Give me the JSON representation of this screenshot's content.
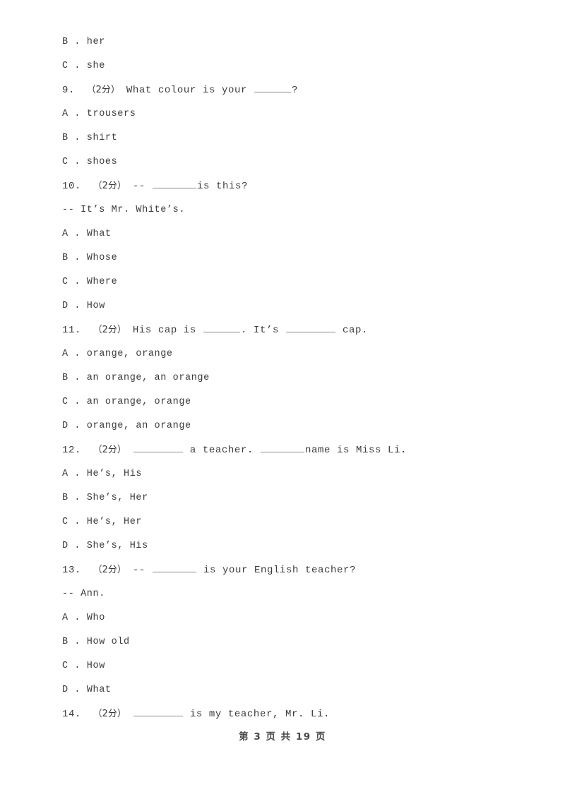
{
  "page": {
    "footer": "第 3 页 共 19 页",
    "page_number": "3",
    "total_pages": "19",
    "text_color": "#3a3a3a",
    "background_color": "#ffffff"
  },
  "lines": [
    {
      "id": "l0",
      "kind": "option",
      "text": "B . her"
    },
    {
      "id": "l1",
      "kind": "option",
      "text": "C . she"
    },
    {
      "id": "l2",
      "kind": "stem",
      "number": "9.",
      "marker": "（2分）",
      "pre": "What colour is your ",
      "blank": "w2",
      "post": "?"
    },
    {
      "id": "l3",
      "kind": "option",
      "text": "A . trousers"
    },
    {
      "id": "l4",
      "kind": "option",
      "text": "B . shirt"
    },
    {
      "id": "l5",
      "kind": "option",
      "text": "C . shoes"
    },
    {
      "id": "l6",
      "kind": "stem",
      "number": "10.",
      "marker": "（2分）",
      "pre": "-- ",
      "blank": "w3",
      "post": "is this?"
    },
    {
      "id": "l7",
      "kind": "dialog",
      "text": "-- It’s Mr. White’s."
    },
    {
      "id": "l8",
      "kind": "option",
      "text": "A . What"
    },
    {
      "id": "l9",
      "kind": "option",
      "text": "B . Whose"
    },
    {
      "id": "l10",
      "kind": "option",
      "text": "C . Where"
    },
    {
      "id": "l11",
      "kind": "option",
      "text": "D . How"
    },
    {
      "id": "l12",
      "kind": "stem2",
      "number": "11.",
      "marker": "（2分）",
      "pre": "His cap is ",
      "blank1": "w2",
      "mid": ". It’s ",
      "blank2": "w4",
      "post": " cap."
    },
    {
      "id": "l13",
      "kind": "option",
      "text": "A . orange, orange"
    },
    {
      "id": "l14",
      "kind": "option",
      "text": "B . an orange, an orange"
    },
    {
      "id": "l15",
      "kind": "option",
      "text": "C . an orange, orange"
    },
    {
      "id": "l16",
      "kind": "option",
      "text": "D . orange, an orange"
    },
    {
      "id": "l17",
      "kind": "stem2",
      "number": "12.",
      "marker": "（2分）",
      "pre": "",
      "blank1": "w4",
      "mid": " a teacher. ",
      "blank2": "w3",
      "post": "name is Miss Li."
    },
    {
      "id": "l18",
      "kind": "option",
      "text": "A . He’s, His"
    },
    {
      "id": "l19",
      "kind": "option",
      "text": "B . She’s, Her"
    },
    {
      "id": "l20",
      "kind": "option",
      "text": "C . He’s, Her"
    },
    {
      "id": "l21",
      "kind": "option",
      "text": "D . She’s, His"
    },
    {
      "id": "l22",
      "kind": "stem",
      "number": "13.",
      "marker": "（2分）",
      "pre": "-- ",
      "blank": "w3",
      "post": " is your English teacher?"
    },
    {
      "id": "l23",
      "kind": "dialog",
      "text": "-- Ann."
    },
    {
      "id": "l24",
      "kind": "option",
      "text": "A . Who"
    },
    {
      "id": "l25",
      "kind": "option",
      "text": "B . How old"
    },
    {
      "id": "l26",
      "kind": "option",
      "text": "C . How"
    },
    {
      "id": "l27",
      "kind": "option",
      "text": "D . What"
    },
    {
      "id": "l28",
      "kind": "stem",
      "number": "14.",
      "marker": "（2分）",
      "pre": "",
      "blank": "w4",
      "post": " is my teacher, Mr. Li."
    }
  ]
}
